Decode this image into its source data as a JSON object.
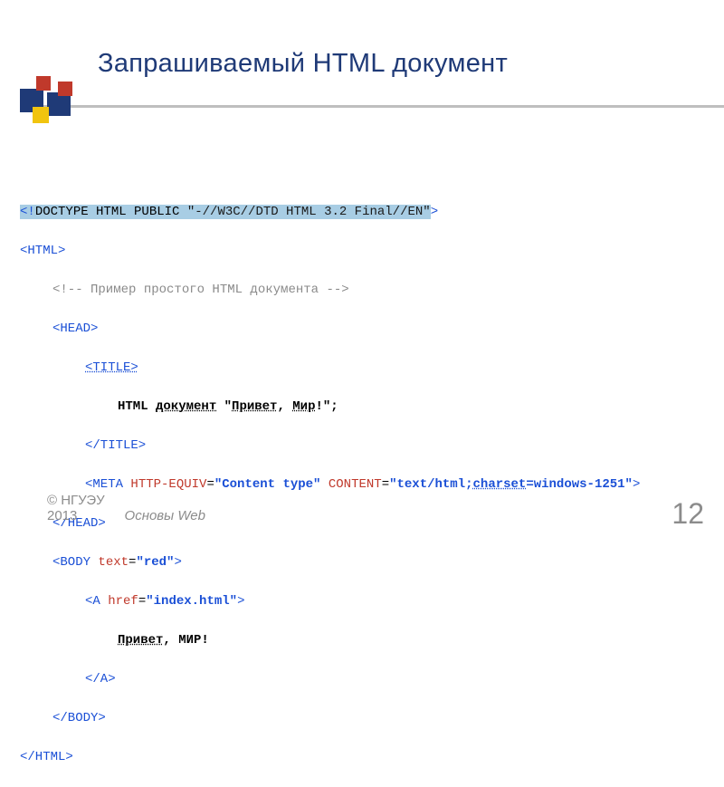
{
  "slide": {
    "title": "Запрашиваемый HTML документ",
    "page_number": "12"
  },
  "footer": {
    "copyright": "© НГУЭУ",
    "year": "2013",
    "course": "Основы Web"
  },
  "code": {
    "doctype_open": "<!",
    "doctype_kw": "DOCTYPE HTML PUBLIC ",
    "doctype_str": "\"-//W3C//DTD HTML 3.2 Final//EN\"",
    "doctype_close": ">",
    "html_open": "<HTML>",
    "comment": "<!-- Пример простого HTML документа -->",
    "head_open": "<HEAD>",
    "title_open": "<TITLE>",
    "title_text_a": "HTML ",
    "title_text_b": "документ",
    "title_text_c": " \"",
    "title_text_d": "Привет",
    "title_text_e": ", ",
    "title_text_f": "Мир",
    "title_text_g": "!\";",
    "title_close": "</TITLE>",
    "meta_open": "<META ",
    "meta_attr1": "HTTP-EQUIV",
    "meta_eq1": "=",
    "meta_val1": "\"Content type\"",
    "meta_sp": " ",
    "meta_attr2": "CONTENT",
    "meta_eq2": "=",
    "meta_val2_a": "\"text/html;",
    "meta_val2_b": "charset",
    "meta_val2_c": "=windows-1251\"",
    "meta_close": ">",
    "head_close": "</HEAD>",
    "body_open_a": "<BODY ",
    "body_attr": "text",
    "body_eq": "=",
    "body_val": "\"red\"",
    "body_open_b": ">",
    "a_open_a": "<A ",
    "a_attr": "href",
    "a_eq": "=",
    "a_val": "\"index.html\"",
    "a_open_b": ">",
    "link_text_a": "Привет",
    "link_text_b": ", МИР!",
    "a_close": "</A>",
    "body_close": "</BODY>",
    "html_close": "</HTML>"
  }
}
